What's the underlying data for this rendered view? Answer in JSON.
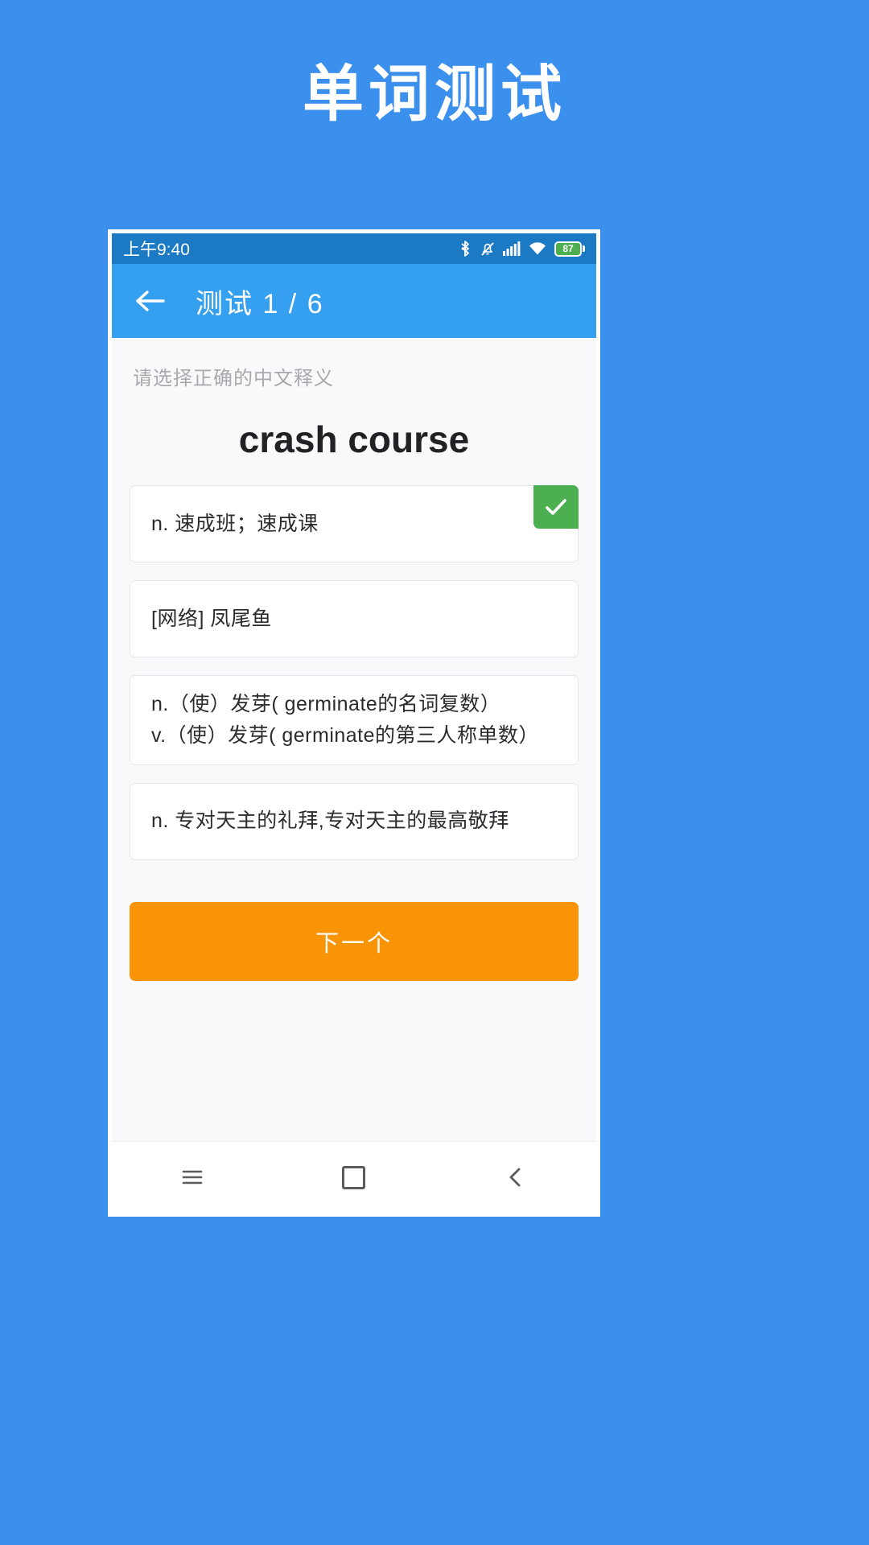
{
  "promo": {
    "title": "单词测试"
  },
  "status_bar": {
    "time": "上午9:40",
    "battery_level": "87",
    "icons": [
      "bluetooth-icon",
      "silent-bell-icon",
      "cellular-signal-icon",
      "wifi-icon",
      "battery-icon"
    ]
  },
  "app_bar": {
    "back_label": "back-arrow",
    "title": "测试 1 / 6",
    "current": "1",
    "total": "6"
  },
  "quiz": {
    "prompt": "请选择正确的中文释义",
    "word": "crash course",
    "options": [
      {
        "text": "n. 速成班；速成课",
        "correct": true
      },
      {
        "text": "[网络] 凤尾鱼",
        "correct": false
      },
      {
        "text": "n.（使）发芽( germinate的名词复数）\nv.（使）发芽( germinate的第三人称单数）",
        "correct": false
      },
      {
        "text": "n. 专对天主的礼拜,专对天主的最高敬拜",
        "correct": false
      }
    ],
    "next_label": "下一个"
  },
  "nav_bar": {
    "menu_label": "menu-icon",
    "home_label": "home-icon",
    "back_label": "back-icon"
  },
  "colors": {
    "background": "#3b8fed",
    "app_bar": "#36a0f0",
    "status_bar": "#1c7ac4",
    "accent_orange": "#f89406",
    "correct_green": "#4caf50"
  }
}
